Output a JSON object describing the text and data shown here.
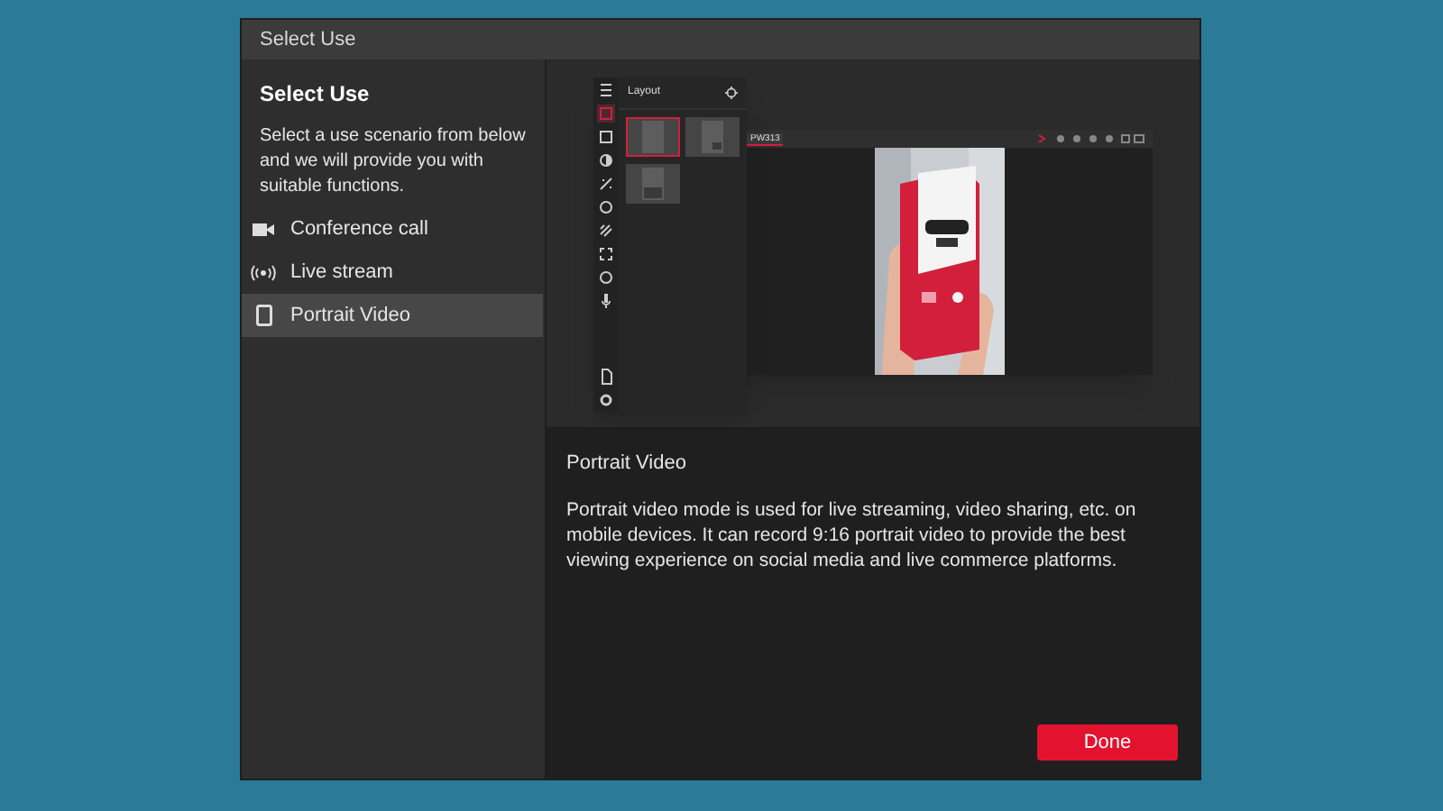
{
  "window": {
    "title": "Select Use"
  },
  "sidebar": {
    "heading": "Select Use",
    "description": "Select a use scenario from below and we will provide you with suitable functions.",
    "items": [
      {
        "label": "Conference call",
        "kind": "camera",
        "selected": false
      },
      {
        "label": "Live stream",
        "kind": "broadcast",
        "selected": false
      },
      {
        "label": "Portrait Video",
        "kind": "phone",
        "selected": true
      }
    ]
  },
  "preview": {
    "layout_panel": {
      "title": "Layout",
      "options": [
        {
          "kind": "full",
          "selected": true
        },
        {
          "kind": "corner",
          "selected": false
        },
        {
          "kind": "bottom",
          "selected": false
        }
      ]
    },
    "app_tab": "PW313"
  },
  "details": {
    "title": "Portrait Video",
    "text": "Portrait video mode is used for live streaming, video sharing, etc. on mobile devices. It can record 9:16 portrait video to provide the best viewing experience on social media and live commerce platforms."
  },
  "done_button": "Done"
}
